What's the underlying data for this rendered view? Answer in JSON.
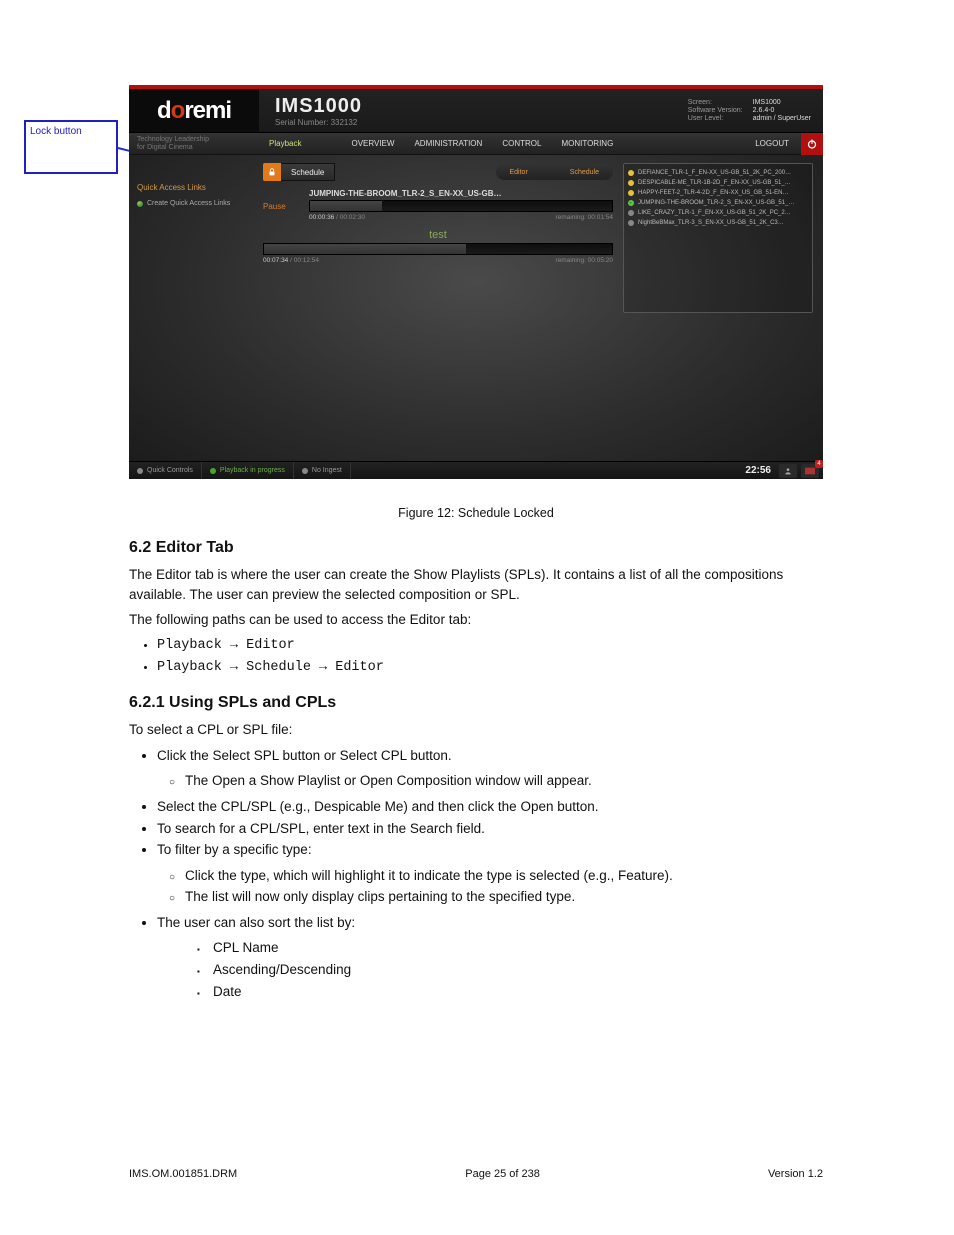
{
  "callout": {
    "label": "Lock button"
  },
  "header": {
    "logo": {
      "d": "d",
      "o": "o",
      "remi": "remi"
    },
    "product": "IMS1000",
    "serial_label": "Serial Number: 332132",
    "meta": {
      "screen_k": "Screen:",
      "screen_v": "IMS1000",
      "sw_k": "Software Version:",
      "sw_v": "2.6.4-0",
      "ul_k": "User Level:",
      "ul_v": "admin / SuperUser"
    }
  },
  "sidehead": {
    "l1": "Technology Leadership",
    "l2": "for Digital Cinema"
  },
  "nav": {
    "playback": "Playback",
    "overview": "OVERVIEW",
    "administration": "ADMINISTRATION",
    "control": "CONTROL",
    "monitoring": "MONITORING",
    "logout": "LOGOUT"
  },
  "sidebar": {
    "title": "Quick Access Links",
    "item1": "Create Quick Access Links"
  },
  "tabs": {
    "schedule": "Schedule",
    "editor": "Editor",
    "schedule2": "Schedule"
  },
  "playback": {
    "clip_title": "JUMPING-THE-BROOM_TLR-2_S_EN-XX_US-GB…",
    "pause": "Pause",
    "clip_cur": "00:00:36",
    "clip_sep": " / ",
    "clip_tot": "00:02:30",
    "clip_rem": "remaining: 00:01:54",
    "clip_fill_pct": 24,
    "spl_name": "test",
    "spl_cur": "00:07:34",
    "spl_tot": "00:12:54",
    "spl_rem": "remaining: 00:05:20",
    "spl_fill_pct": 58
  },
  "playlist": [
    {
      "dot": "y",
      "name": "DEFIANCE_TLR-1_F_EN-XX_US-GB_51_2K_PC_200…"
    },
    {
      "dot": "y",
      "name": "DESPICABLE-ME_TLR-1B-2D_F_EN-XX_US-GB_51_…"
    },
    {
      "dot": "y",
      "name": "HAPPY-FEET-2_TLR-4-2D_F_EN-XX_US_GB_51-EN…"
    },
    {
      "dot": "g",
      "name": "JUMPING-THE-BROOM_TLR-2_S_EN-XX_US-GB_51_…"
    },
    {
      "dot": "gr",
      "name": "LIKE_CRAZY_TLR-1_F_EN-XX_US-GB_51_2K_PC_2…"
    },
    {
      "dot": "gr",
      "name": "NightBeBMax_TLR-3_S_EN-XX_US-GB_51_2K_C3…"
    }
  ],
  "footer": {
    "quick": "Quick Controls",
    "status": "Playback in progress",
    "ingest": "No Ingest",
    "clock": "22:56",
    "notif_count": "4"
  },
  "doc": {
    "caption": "Figure 12: Schedule Locked",
    "h1": "6.2 Editor Tab",
    "p1": "The Editor tab is where the user can create the Show Playlists (SPLs). It contains a list of all the compositions available. The user can preview the selected composition or SPL.",
    "p2": "The following paths can be used to access the Editor tab:",
    "li1": "Playback → Editor",
    "li2": "Playback → Schedule → Editor",
    "h2": "6.2.1 Using SPLs and CPLs",
    "p3": "To select a CPL or SPL file:",
    "li3": "Click the Select SPL button or Select CPL button.",
    "li3a": "The Open a Show Playlist or Open Composition window will appear.",
    "li4": "Select the CPL/SPL (e.g., Despicable Me) and then click the Open button.",
    "li5": "To search for a CPL/SPL, enter text in the Search field.",
    "li6": "To filter by a specific type:",
    "li6a": "Click the type, which will highlight it to indicate the type is selected (e.g., Feature).",
    "li6b": "The list will now only display clips pertaining to the specified type.",
    "li7": "The user can also sort the list by:",
    "li7a": "CPL Name",
    "li7b": "Ascending/Descending",
    "li7c": "Date"
  },
  "pgfoot": {
    "left": "IMS.OM.001851.DRM",
    "center": "Page 25 of 238",
    "right": "Version 1.2"
  }
}
